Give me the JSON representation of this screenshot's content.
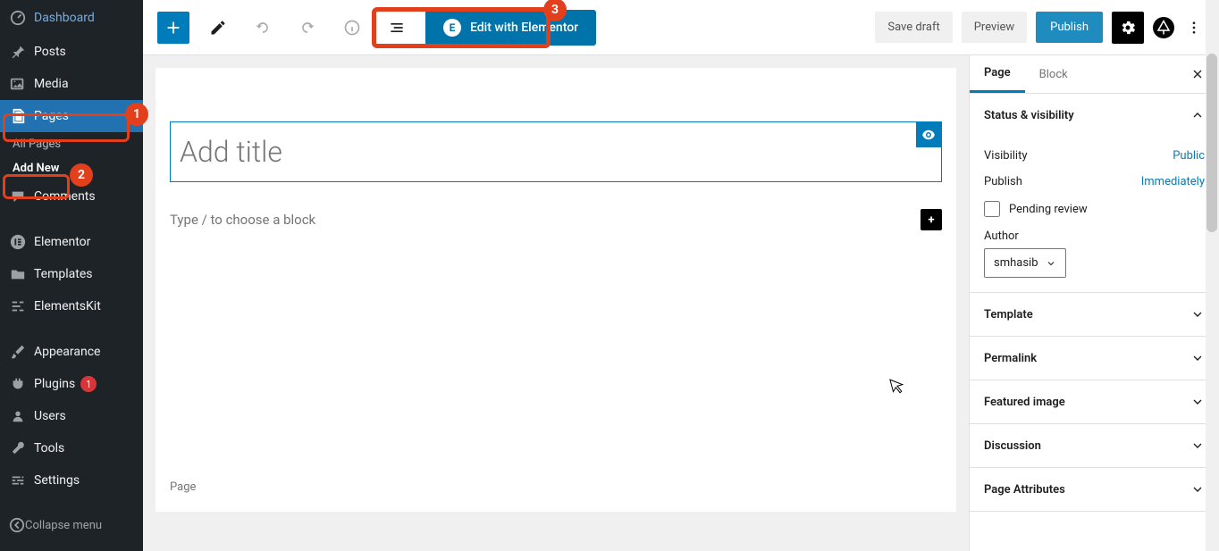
{
  "sidebar": {
    "items": [
      {
        "icon": "dashboard",
        "label": "Dashboard"
      },
      {
        "icon": "pin",
        "label": "Posts"
      },
      {
        "icon": "media",
        "label": "Media"
      },
      {
        "icon": "pages",
        "label": "Pages"
      },
      {
        "icon": "comments",
        "label": "Comments"
      },
      {
        "icon": "elementor",
        "label": "Elementor"
      },
      {
        "icon": "templates",
        "label": "Templates"
      },
      {
        "icon": "elementskit",
        "label": "ElementsKit"
      },
      {
        "icon": "appearance",
        "label": "Appearance"
      },
      {
        "icon": "plugins",
        "label": "Plugins",
        "badge": "1"
      },
      {
        "icon": "users",
        "label": "Users"
      },
      {
        "icon": "tools",
        "label": "Tools"
      },
      {
        "icon": "settings",
        "label": "Settings"
      }
    ],
    "sub": {
      "all": "All Pages",
      "add": "Add New"
    },
    "collapse": "Collapse menu"
  },
  "toolbar": {
    "elementor_label": "Edit with Elementor",
    "save_draft": "Save draft",
    "preview": "Preview",
    "publish": "Publish"
  },
  "editor": {
    "title_placeholder": "Add title",
    "block_placeholder": "Type / to choose a block",
    "breadcrumb": "Page"
  },
  "panel": {
    "tabs": {
      "page": "Page",
      "block": "Block"
    },
    "sections": {
      "status": {
        "title": "Status & visibility",
        "visibility_label": "Visibility",
        "visibility_value": "Public",
        "publish_label": "Publish",
        "publish_value": "Immediately",
        "pending_label": "Pending review",
        "author_label": "Author",
        "author_value": "smhasib"
      },
      "template": "Template",
      "permalink": "Permalink",
      "featured": "Featured image",
      "discussion": "Discussion",
      "attributes": "Page Attributes"
    }
  },
  "annotations": {
    "n1": "1",
    "n2": "2",
    "n3": "3"
  }
}
